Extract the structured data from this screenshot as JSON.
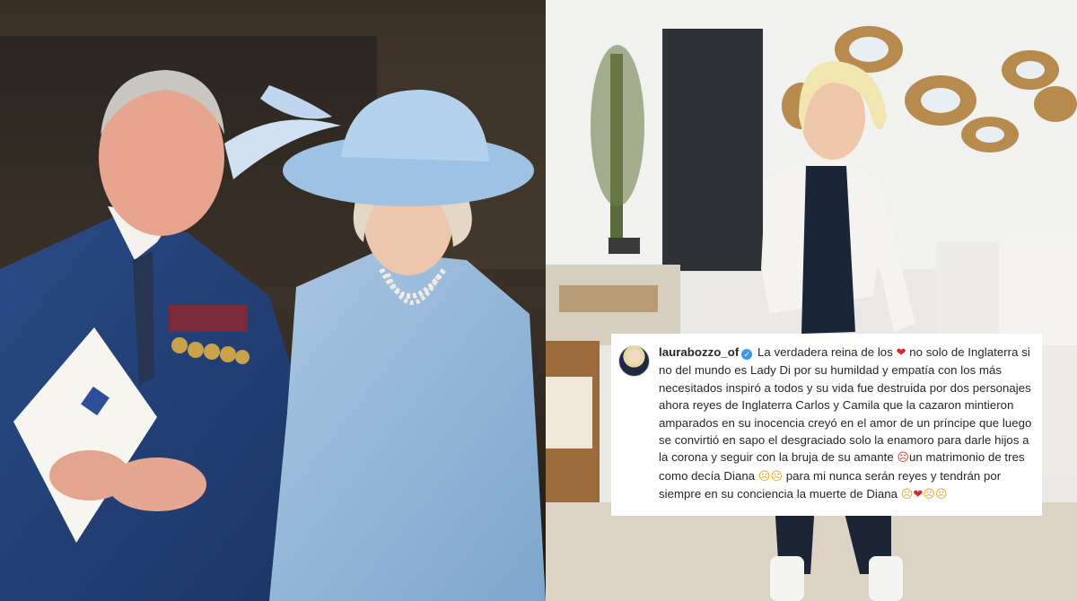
{
  "post": {
    "username": "laurabozzo_of",
    "text_1": " La verdadera reina de los ",
    "text_2": " no solo de Inglaterra si no del mundo es Lady Di por su humildad y empatía con los más necesitados inspiró a todos y su vida fue destruida por dos personajes ahora reyes de Inglaterra Carlos y Camila que la cazaron mintieron amparados en su inocencia creyó en el amor de un príncipe que luego se convirtió en sapo el desgraciado solo la enamoro para darle hijos a la corona y seguir con la bruja de su amante ",
    "text_3": "un matrimonio de tres como decía Diana ",
    "text_4": " para mi nunca serán reyes y tendrán por siempre en su conciencia la muerte de Diana ",
    "emoji_heart": "❤",
    "emoji_angry": "☹",
    "emoji_sad": "☹",
    "emoji_scream": "☹"
  },
  "colors": {
    "heart": "#e0242b",
    "verified": "#3897f0",
    "text": "#262626"
  },
  "icons": {
    "verified": "verified-badge-icon",
    "avatar": "profile-avatar"
  }
}
